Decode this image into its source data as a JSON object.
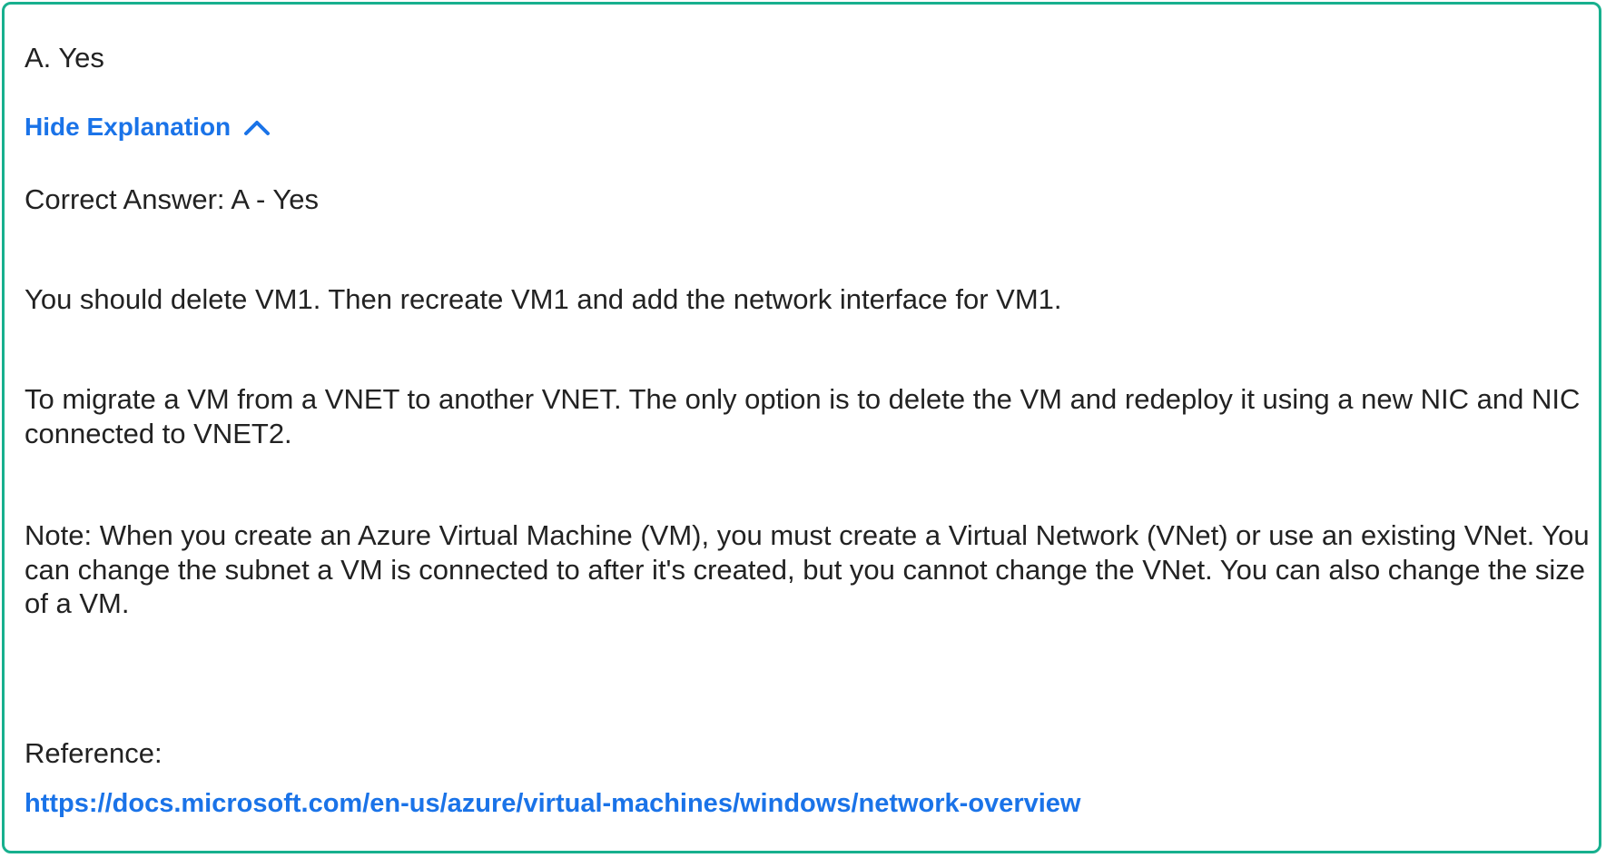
{
  "answer": {
    "label": "A. Yes"
  },
  "explanation_toggle": {
    "label": "Hide Explanation",
    "icon": "chevron-up-icon",
    "color": "#1a73e8"
  },
  "explanation": {
    "correct_answer": "Correct Answer: A - Yes",
    "paragraph_delete": "You should delete VM1. Then recreate VM1 and add the network interface for VM1.",
    "paragraph_migrate": "To migrate a VM from a VNET to another VNET. The only option is to delete the VM and redeploy it using a new NIC and NIC connected to VNET2.",
    "paragraph_note": "Note: When you create an Azure Virtual Machine (VM), you must create a Virtual Network (VNet) or use an existing VNet. You can change the subnet a VM is connected to after it's created, but you cannot change the VNet. You can also change the size of a VM.",
    "reference_label": "Reference:",
    "reference_link": "https://docs.microsoft.com/en-us/azure/virtual-machines/windows/network-overview"
  },
  "theme": {
    "border_color": "#17b08e",
    "link_color": "#1a73e8",
    "text_color": "#222222"
  }
}
